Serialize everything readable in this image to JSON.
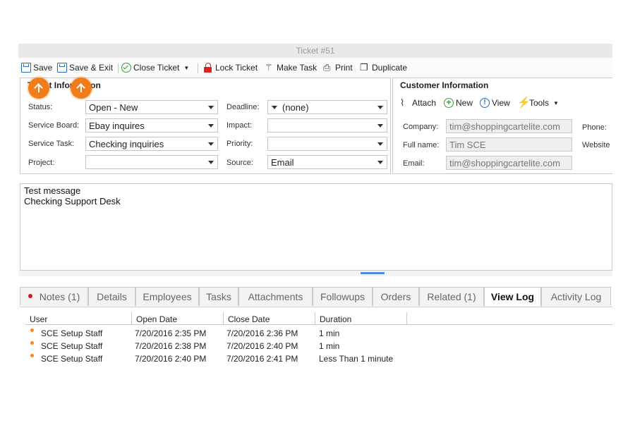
{
  "window": {
    "title": "Ticket #51"
  },
  "toolbar": {
    "save": "Save",
    "save_exit": "Save & Exit",
    "close_ticket": "Close Ticket",
    "lock_ticket": "Lock Ticket",
    "make_task": "Make Task",
    "print": "Print",
    "duplicate": "Duplicate"
  },
  "ticket_info": {
    "heading": "Ticket Information",
    "status_label": "Status:",
    "status_value": "Open - New",
    "service_board_label": "Service Board:",
    "service_board_value": "Ebay inquires",
    "service_task_label": "Service Task:",
    "service_task_value": "Checking inquiries",
    "project_label": "Project:",
    "project_value": "",
    "deadline_label": "Deadline:",
    "deadline_value": "(none)",
    "impact_label": "Impact:",
    "impact_value": "",
    "priority_label": "Priority:",
    "priority_value": "",
    "source_label": "Source:",
    "source_value": "Email"
  },
  "customer_info": {
    "heading": "Customer Information",
    "attach": "Attach",
    "new": "New",
    "view": "View",
    "tools": "Tools",
    "company_label": "Company:",
    "company_value": "tim@shoppingcartelite.com",
    "fullname_label": "Full name:",
    "fullname_value": "Tim SCE",
    "email_label": "Email:",
    "email_value": "tim@shoppingcartelite.com",
    "phone_label": "Phone:",
    "website_label": "Website"
  },
  "message": {
    "line1": "Test message",
    "line2": "Checking Support Desk"
  },
  "tabs": [
    "Notes (1)",
    "Details",
    "Employees",
    "Tasks",
    "Attachments",
    "Followups",
    "Orders",
    "Related (1)",
    "View Log",
    "Activity Log"
  ],
  "active_tab": "View Log",
  "log": {
    "columns": [
      "User",
      "Open Date",
      "Close Date",
      "Duration"
    ],
    "rows": [
      [
        "SCE Setup Staff",
        "7/20/2016 2:35 PM",
        "7/20/2016 2:36 PM",
        "1 min"
      ],
      [
        "SCE Setup Staff",
        "7/20/2016 2:38 PM",
        "7/20/2016 2:40 PM",
        "1 min"
      ],
      [
        "SCE Setup Staff",
        "7/20/2016 2:40 PM",
        "7/20/2016 2:41 PM",
        "Less Than 1 minute"
      ]
    ]
  },
  "colors": {
    "accent_orange": "#f07d1a",
    "tab_active_text": "#111111",
    "link_blue": "#2d6db5"
  }
}
